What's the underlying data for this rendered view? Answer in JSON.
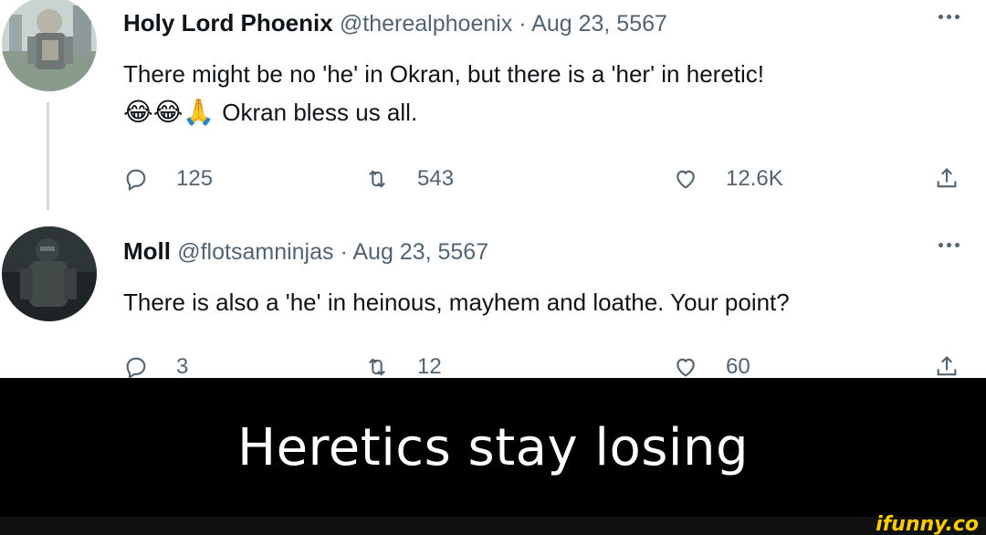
{
  "tweets": [
    {
      "author_name": "Holy Lord Phoenix",
      "handle": "@therealphoenix",
      "separator": " · ",
      "date": "Aug 23, 5567",
      "text_line1": "There might be no 'he' in Okran, but there is a 'her' in heretic!",
      "emojis": "😂😂🙏",
      "text_line2": "Okran bless us all.",
      "replies": "125",
      "retweets": "543",
      "likes": "12.6K"
    },
    {
      "author_name": "Moll",
      "handle": "@flotsamninjas",
      "separator": " · ",
      "date": "Aug 23, 5567",
      "text_line1": "There is also a 'he' in heinous, mayhem and loathe. Your point?",
      "replies": "3",
      "retweets": "12",
      "likes": "60"
    }
  ],
  "caption": "Heretics stay losing",
  "watermark": "ifunny.co",
  "icons": {
    "reply": "reply-icon",
    "retweet": "retweet-icon",
    "like": "heart-icon",
    "share": "share-icon",
    "more": "more-icon"
  },
  "colors": {
    "text": "#0f1419",
    "muted": "#536471",
    "thread_line": "#cfd9de",
    "caption_bg": "#000000",
    "watermark": "#ffcc00"
  }
}
